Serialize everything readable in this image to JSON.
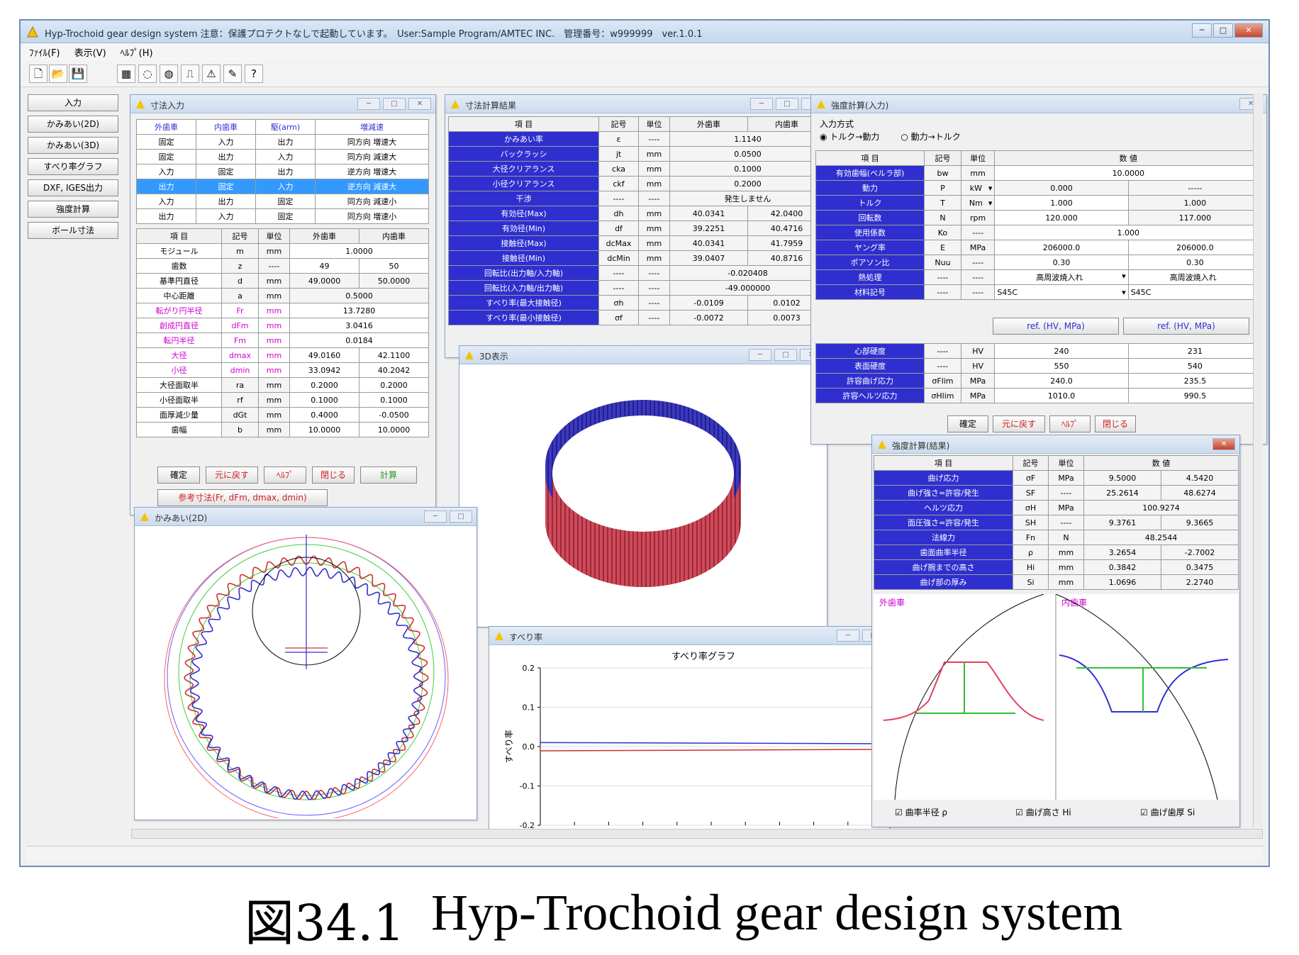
{
  "app": {
    "title": "Hyp-Trochoid gear design system 注意：保護プロテクトなしで起動しています。　User:Sample Program/AMTEC INC.　管理番号：w999999　ver.1.0.1",
    "menu": [
      "ﾌｧｲﾙ(F)",
      "表示(V)",
      "ﾍﾙﾌﾟ(H)"
    ]
  },
  "nav": [
    "入力",
    "かみあい(2D)",
    "かみあい(3D)",
    "すべり率グラフ",
    "DXF, IGES出力",
    "強度計算",
    "ボール寸法"
  ],
  "spec_window": {
    "title": "寸法入力",
    "combo_headers": [
      "外歯車",
      "内歯車",
      "駆(arm)",
      "増減速"
    ],
    "combo_rows": [
      [
        "固定",
        "入力",
        "出力",
        "同方向 増速大"
      ],
      [
        "固定",
        "出力",
        "入力",
        "同方向 減速大"
      ],
      [
        "入力",
        "固定",
        "出力",
        "逆方向 増速大"
      ],
      [
        "出力",
        "固定",
        "入力",
        "逆方向 減速大"
      ],
      [
        "入力",
        "出力",
        "固定",
        "同方向 減速小"
      ],
      [
        "出力",
        "入力",
        "固定",
        "同方向 増速小"
      ]
    ],
    "table_headers": [
      "項 目",
      "記号",
      "単位",
      "外歯車",
      "内歯車"
    ],
    "rows": [
      {
        "label": "モジュール",
        "sym": "m",
        "unit": "mm",
        "v": "1.0000"
      },
      {
        "label": "歯数",
        "sym": "z",
        "unit": "----",
        "a": "49",
        "b": "50"
      },
      {
        "label": "基準円直径",
        "sym": "d",
        "unit": "mm",
        "a": "49.0000",
        "b": "50.0000"
      },
      {
        "label": "中心距離",
        "sym": "a",
        "unit": "mm",
        "v": "0.5000"
      },
      {
        "label": "転がり円半径",
        "sym": "Fr",
        "unit": "mm",
        "v": "13.7280"
      },
      {
        "label": "創成円直径",
        "sym": "dFm",
        "unit": "mm",
        "v": "3.0416"
      },
      {
        "label": "転円半径",
        "sym": "Fm",
        "unit": "mm",
        "v": "0.0184"
      },
      {
        "label": "大径",
        "sym": "dmax",
        "unit": "mm",
        "a": "49.0160",
        "b": "42.1100"
      },
      {
        "label": "小径",
        "sym": "dmin",
        "unit": "mm",
        "a": "33.0942",
        "b": "40.2042"
      },
      {
        "label": "大径面取半",
        "sym": "ra",
        "unit": "mm",
        "a": "0.2000",
        "b": "0.2000"
      },
      {
        "label": "小径面取半",
        "sym": "rf",
        "unit": "mm",
        "a": "0.1000",
        "b": "0.1000"
      },
      {
        "label": "面厚減少量",
        "sym": "dGt",
        "unit": "mm",
        "a": "0.4000",
        "b": "-0.0500"
      },
      {
        "label": "歯幅",
        "sym": "b",
        "unit": "mm",
        "a": "10.0000",
        "b": "10.0000"
      }
    ],
    "buttons": [
      "確定",
      "元に戻す",
      "ﾍﾙﾌﾟ",
      "閉じる",
      "計算"
    ],
    "ref_button": "参考寸法(Fr, dFm, dmax, dmin)"
  },
  "result_window": {
    "title": "寸法計算結果",
    "headers": [
      "項 目",
      "記号",
      "単位",
      "外歯車",
      "内歯車"
    ],
    "rows": [
      {
        "label": "かみあい率",
        "sym": "ε",
        "unit": "----",
        "v": "1.1140"
      },
      {
        "label": "バックラッシ",
        "sym": "jt",
        "unit": "mm",
        "v": "0.0500"
      },
      {
        "label": "大径クリアランス",
        "sym": "cka",
        "unit": "mm",
        "v": "0.1000"
      },
      {
        "label": "小径クリアランス",
        "sym": "ckf",
        "unit": "mm",
        "v": "0.2000"
      },
      {
        "label": "干渉",
        "sym": "----",
        "unit": "----",
        "v": "発生しません"
      },
      {
        "label": "有効径(Max)",
        "sym": "dh",
        "unit": "mm",
        "a": "40.0341",
        "b": "42.0400"
      },
      {
        "label": "有効径(Min)",
        "sym": "df",
        "unit": "mm",
        "a": "39.2251",
        "b": "40.4716"
      },
      {
        "label": "接触径(Max)",
        "sym": "dcMax",
        "unit": "mm",
        "a": "40.0341",
        "b": "41.7959"
      },
      {
        "label": "接触径(Min)",
        "sym": "dcMin",
        "unit": "mm",
        "a": "39.0407",
        "b": "40.8716"
      },
      {
        "label": "回転比(出力軸/入力軸)",
        "sym": "----",
        "unit": "----",
        "v": "-0.020408"
      },
      {
        "label": "回転比(入力軸/出力軸)",
        "sym": "----",
        "unit": "----",
        "v": "-49.000000"
      },
      {
        "label": "すべり率(最大接触径)",
        "sym": "σh",
        "unit": "----",
        "a": "-0.0109",
        "b": "0.0102"
      },
      {
        "label": "すべり率(最小接触径)",
        "sym": "σf",
        "unit": "----",
        "a": "-0.0072",
        "b": "0.0073"
      }
    ]
  },
  "view3d": {
    "title": "3D表示"
  },
  "mesh2d": {
    "title": "かみあい(2D)"
  },
  "slip": {
    "title": "すべり率",
    "chart_title": "すべり率グラフ",
    "ylabel": "すべり率",
    "ticks": [
      "0.2",
      "0.1",
      "0.0",
      "-0.1",
      "-0.2"
    ]
  },
  "chart_data": {
    "type": "line",
    "title": "すべり率グラフ",
    "ylabel": "すべり率",
    "ylim": [
      -0.2,
      0.2
    ],
    "yticks": [
      0.2,
      0.1,
      0.0,
      -0.1,
      -0.2
    ],
    "series": [
      {
        "values": [
          -0.0109,
          -0.0072
        ],
        "color": "#d03030"
      },
      {
        "values": [
          0.0102,
          0.0073
        ],
        "color": "#3030d0"
      }
    ]
  },
  "strength_in": {
    "title": "強度計算(入力)",
    "mode_label": "入力方式",
    "mode_opts": [
      "トルク→動力",
      "動力→トルク"
    ],
    "headers": [
      "項 目",
      "記号",
      "単位",
      "数 値"
    ],
    "rows": [
      {
        "label": "有効歯幅(ベルラ部)",
        "sym": "bw",
        "unit": "mm",
        "v": "10.0000"
      },
      {
        "label": "動力",
        "sym": "P",
        "unit": "kW",
        "a": "0.000",
        "b": "-----"
      },
      {
        "label": "トルク",
        "sym": "T",
        "unit": "Nm",
        "a": "1.000",
        "b": "1.000"
      },
      {
        "label": "回転数",
        "sym": "N",
        "unit": "rpm",
        "a": "120.000",
        "b": "117.000"
      },
      {
        "label": "使用係数",
        "sym": "Ko",
        "unit": "----",
        "v": "1.000"
      },
      {
        "label": "ヤング率",
        "sym": "E",
        "unit": "MPa",
        "a": "206000.0",
        "b": "206000.0"
      },
      {
        "label": "ポアソン比",
        "sym": "Nuu",
        "unit": "----",
        "a": "0.30",
        "b": "0.30"
      },
      {
        "label": "熱処理",
        "sym": "----",
        "unit": "----",
        "a": "高周波焼入れ",
        "b": "高周波焼入れ"
      },
      {
        "label": "材料記号",
        "sym": "----",
        "unit": "----",
        "a": "S45C",
        "b": "S45C"
      }
    ],
    "hv_buttons": [
      "ref. (HV, MPa)",
      "ref. (HV, MPa)"
    ],
    "rows2": [
      {
        "label": "心部硬度",
        "sym": "----",
        "unit": "HV",
        "a": "240",
        "b": "231"
      },
      {
        "label": "表面硬度",
        "sym": "----",
        "unit": "HV",
        "a": "550",
        "b": "540"
      },
      {
        "label": "許容曲げ応力",
        "sym": "σFlim",
        "unit": "MPa",
        "a": "240.0",
        "b": "235.5"
      },
      {
        "label": "許容ヘルツ応力",
        "sym": "σHlim",
        "unit": "MPa",
        "a": "1010.0",
        "b": "990.5"
      }
    ],
    "buttons": [
      "確定",
      "元に戻す",
      "ﾍﾙﾌﾟ",
      "閉じる"
    ]
  },
  "strength_res": {
    "title": "強度計算(結果)",
    "headers": [
      "項 目",
      "記号",
      "単位",
      "数 値"
    ],
    "rows": [
      {
        "label": "曲げ応力",
        "sym": "σF",
        "unit": "MPa",
        "a": "9.5000",
        "b": "4.5420"
      },
      {
        "label": "曲げ強さ=許容/発生",
        "sym": "SF",
        "unit": "----",
        "a": "25.2614",
        "b": "48.6274"
      },
      {
        "label": "ヘルツ応力",
        "sym": "σH",
        "unit": "MPa",
        "v": "100.9274"
      },
      {
        "label": "面圧強さ=許容/発生",
        "sym": "SH",
        "unit": "----",
        "a": "9.3761",
        "b": "9.3665"
      },
      {
        "label": "法線力",
        "sym": "Fn",
        "unit": "N",
        "v": "48.2544"
      },
      {
        "label": "歯面曲率半径",
        "sym": "ρ",
        "unit": "mm",
        "a": "3.2654",
        "b": "-2.7002"
      },
      {
        "label": "曲げ腕までの高さ",
        "sym": "Hi",
        "unit": "mm",
        "a": "0.3842",
        "b": "0.3475"
      },
      {
        "label": "曲げ部の厚み",
        "sym": "Si",
        "unit": "mm",
        "a": "1.0696",
        "b": "2.2740"
      }
    ],
    "ext_label": "外歯車",
    "int_label": "内歯車",
    "checks": [
      "曲率半径 ρ",
      "曲げ高さ Hi",
      "曲げ歯厚 Si"
    ]
  },
  "caption": {
    "fig": "図34.1",
    "text": "Hyp-Trochoid gear design system"
  }
}
